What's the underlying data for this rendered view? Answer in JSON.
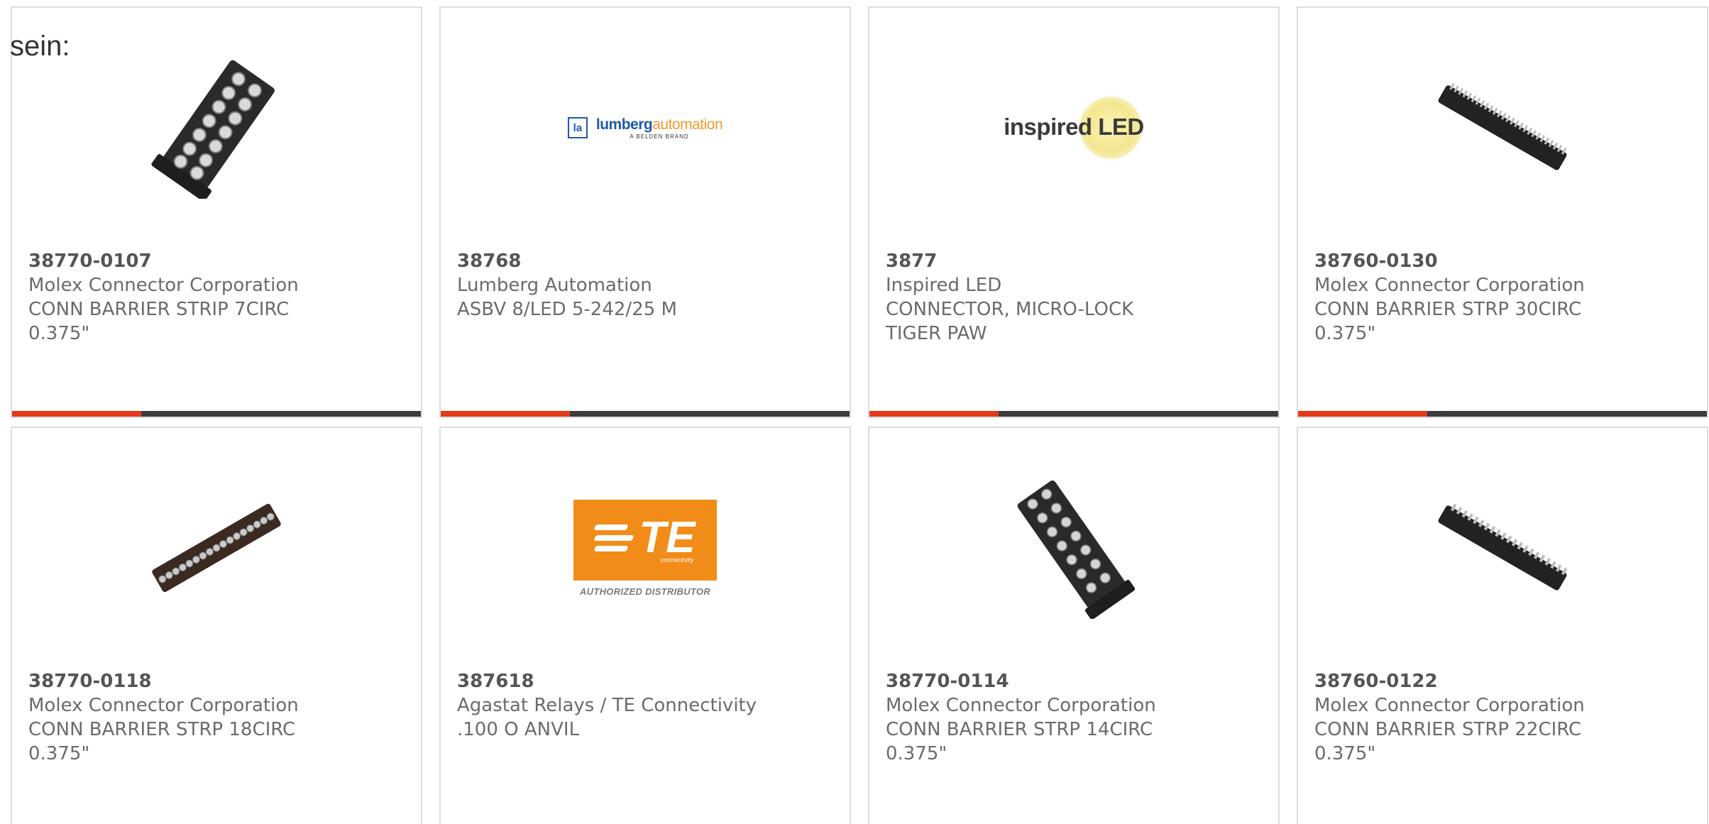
{
  "lead_text": "sein:",
  "products": [
    {
      "part_number": "38770-0107",
      "manufacturer": "Molex Connector Corporation",
      "description_lines": [
        "CONN BARRIER STRIP 7CIRC",
        "0.375\""
      ],
      "image": "barrier-strip-7-image"
    },
    {
      "part_number": "38768",
      "manufacturer": "Lumberg Automation",
      "description_lines": [
        "ASBV 8/LED 5-242/25 M"
      ],
      "image": "lumberg-automation-logo",
      "logo": {
        "box_letter": "la",
        "brand_main": "lumberg",
        "brand_accent": "automation",
        "tagline": "A BELDEN BRAND"
      }
    },
    {
      "part_number": "3877",
      "manufacturer": "Inspired LED",
      "description_lines": [
        "CONNECTOR, MICRO-LOCK",
        "TIGER PAW"
      ],
      "image": "inspired-led-logo",
      "logo": {
        "text": "inspired LED"
      }
    },
    {
      "part_number": "38760-0130",
      "manufacturer": "Molex Connector Corporation",
      "description_lines": [
        "CONN BARRIER STRP 30CIRC",
        "0.375\""
      ],
      "image": "barrier-strip-30-image"
    },
    {
      "part_number": "38770-0118",
      "manufacturer": "Molex Connector Corporation",
      "description_lines": [
        "CONN BARRIER STRP 18CIRC",
        "0.375\""
      ],
      "image": "barrier-strip-18-image"
    },
    {
      "part_number": "387618",
      "manufacturer": "Agastat Relays / TE Connectivity",
      "description_lines": [
        ".100 O ANVIL"
      ],
      "image": "te-connectivity-logo",
      "logo": {
        "letters": "TE",
        "sub": "connectivity",
        "caption": "AUTHORIZED DISTRIBUTOR"
      }
    },
    {
      "part_number": "38770-0114",
      "manufacturer": "Molex Connector Corporation",
      "description_lines": [
        "CONN BARRIER STRP 14CIRC",
        "0.375\""
      ],
      "image": "barrier-strip-14-image"
    },
    {
      "part_number": "38760-0122",
      "manufacturer": "Molex Connector Corporation",
      "description_lines": [
        "CONN BARRIER STRP 22CIRC",
        "0.375\""
      ],
      "image": "barrier-strip-22-image"
    }
  ],
  "colors": {
    "accent": "#e4391b",
    "bar_dark": "#3c3c3c",
    "card_border": "#dcdcdc",
    "text": "#6b6b6b",
    "lumberg_blue": "#1e5aa8",
    "lumberg_orange": "#f29a2e",
    "te_orange": "#f28c18"
  }
}
